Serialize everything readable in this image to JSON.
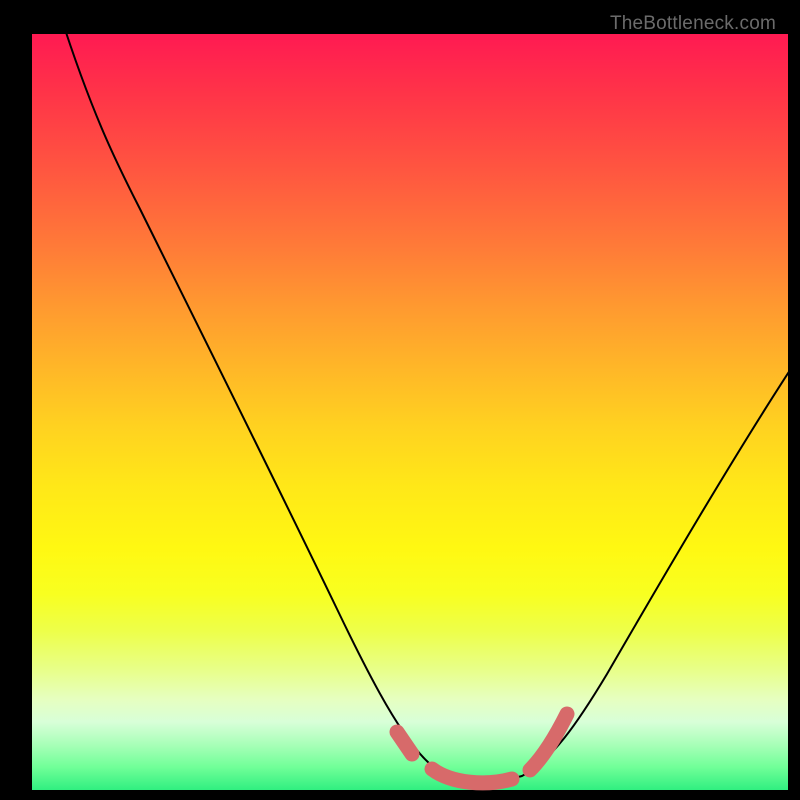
{
  "attribution": "TheBottleneck.com",
  "chart_data": {
    "type": "line",
    "title": "",
    "xlabel": "",
    "ylabel": "",
    "x": [
      0.0,
      0.05,
      0.1,
      0.15,
      0.2,
      0.25,
      0.3,
      0.35,
      0.4,
      0.45,
      0.5,
      0.55,
      0.6,
      0.65,
      0.7,
      0.75,
      0.8,
      0.85,
      0.9,
      0.95,
      1.0
    ],
    "values": [
      1.03,
      0.88,
      0.77,
      0.68,
      0.59,
      0.5,
      0.41,
      0.32,
      0.23,
      0.14,
      0.06,
      0.01,
      0.0,
      0.01,
      0.05,
      0.12,
      0.21,
      0.3,
      0.39,
      0.48,
      0.57
    ],
    "ylim": [
      0,
      1
    ],
    "xlim": [
      0,
      1
    ],
    "highlight_range_x": [
      0.49,
      0.66
    ],
    "notes": "Bottleneck-style V-curve on rainbow gradient background; minimum sits near x≈0.58; pink dashed segment marks the low region around the trough."
  },
  "colors": {
    "curve": "#000000",
    "highlight": "#d76a6a",
    "background_top": "#ff1a52",
    "background_bottom": "#30ef80"
  }
}
